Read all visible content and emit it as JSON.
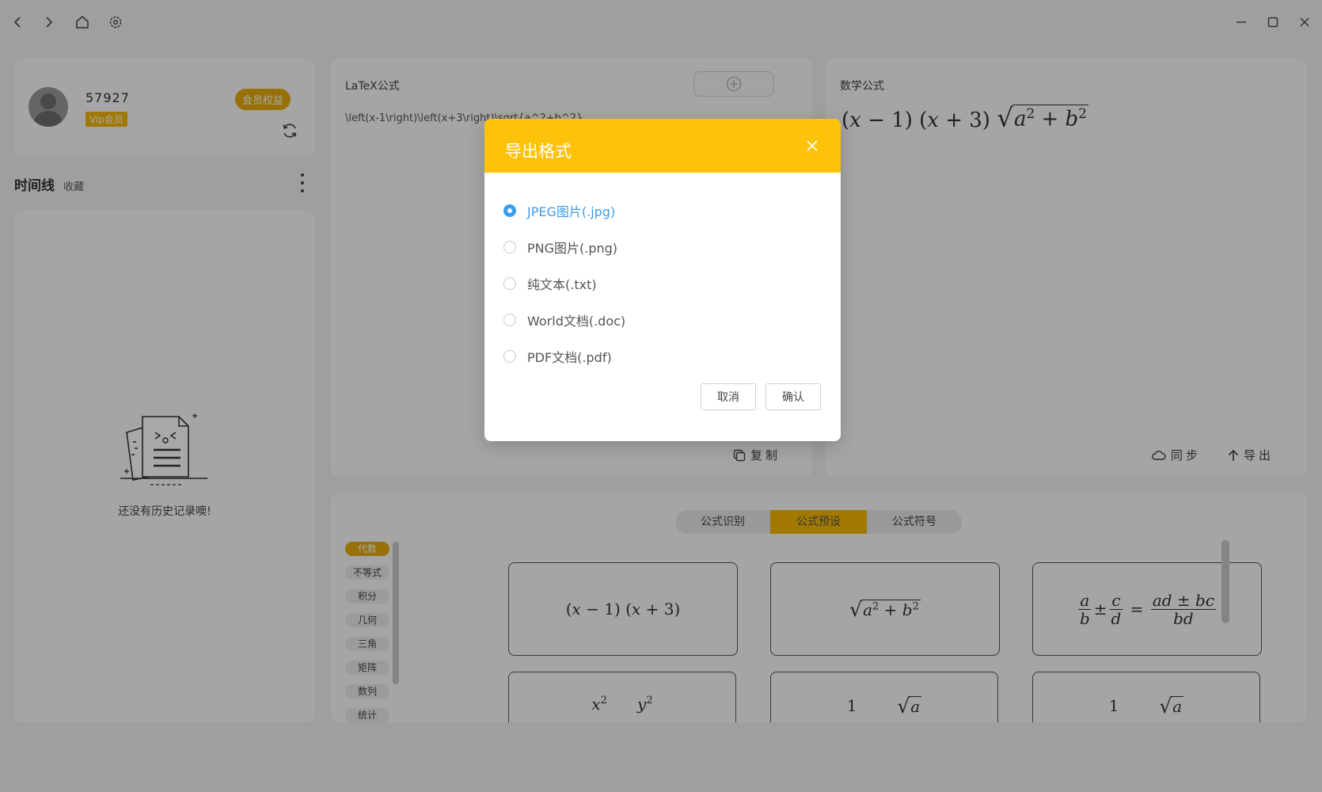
{
  "titlebar": {
    "back_icon": "‹",
    "forward_icon": "›"
  },
  "user": {
    "name": "57927",
    "vip_label": "Vip会员",
    "member_button": "会员权益"
  },
  "timeline": {
    "title": "时间线",
    "subtitle": "收藏",
    "empty_text": "还没有历史记录噢!"
  },
  "latex_panel": {
    "label": "LaTeX公式",
    "source": "\\left(x-1\\right)\\left(x+3\\right)\\sqrt{a^2+b^2}",
    "copy_label": "复制"
  },
  "math_panel": {
    "label": "数学公式",
    "sync_label": "同步",
    "export_label": "导出"
  },
  "bottom": {
    "tabs": [
      "公式识别",
      "公式预设",
      "公式符号"
    ],
    "active_tab": "公式预设",
    "categories": [
      "代数",
      "不等式",
      "积分",
      "几何",
      "三角",
      "矩阵",
      "数列",
      "统计"
    ],
    "active_category": "代数"
  },
  "dialog": {
    "title": "导出格式",
    "options": [
      "JPEG图片(.jpg)",
      "PNG图片(.png)",
      "纯文本(.txt)",
      "World文档(.doc)",
      "PDF文档(.pdf)"
    ],
    "selected": "JPEG图片(.jpg)",
    "cancel_label": "取消",
    "confirm_label": "确认"
  },
  "colors": {
    "accent": "#ffc20b",
    "accent_dark": "#e6ac0c",
    "selected_blue": "#3d9ce8"
  }
}
